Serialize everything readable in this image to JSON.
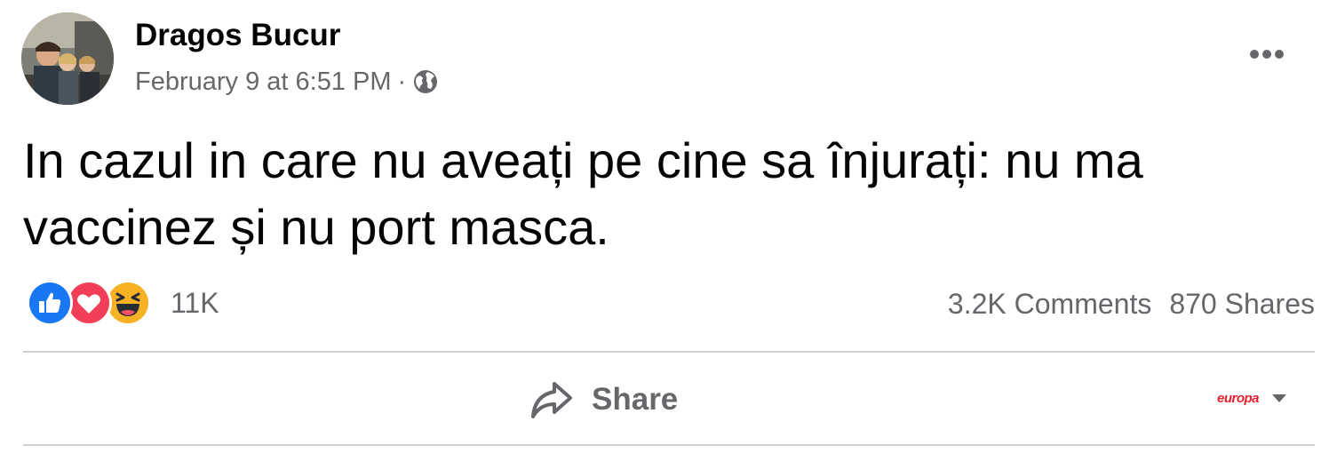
{
  "post": {
    "author": "Dragos Bucur",
    "timestamp": "February 9 at 6:51 PM",
    "separator": "·",
    "privacy_icon": "globe-icon",
    "more_icon": "more-options-icon",
    "text_lines": [
      "In cazul in care nu aveați pe cine sa înjurați: nu ma",
      "vaccinez și nu port masca."
    ]
  },
  "reactions": {
    "icons": [
      "like-icon",
      "love-icon",
      "haha-icon"
    ],
    "count": "11K"
  },
  "stats": {
    "comments": "3.2K Comments",
    "shares": "870 Shares"
  },
  "actions": {
    "share_label": "Share",
    "share_icon": "share-arrow-icon"
  },
  "page_selector": {
    "brand": "europa",
    "caret_icon": "caret-down-icon"
  },
  "colors": {
    "text_primary": "#050505",
    "text_secondary": "#65676b",
    "like_blue": "#1877f2",
    "love_red": "#f33e58",
    "haha_yellow": "#f7b125",
    "divider": "#ced0d4",
    "brand_red": "#e5202e"
  }
}
